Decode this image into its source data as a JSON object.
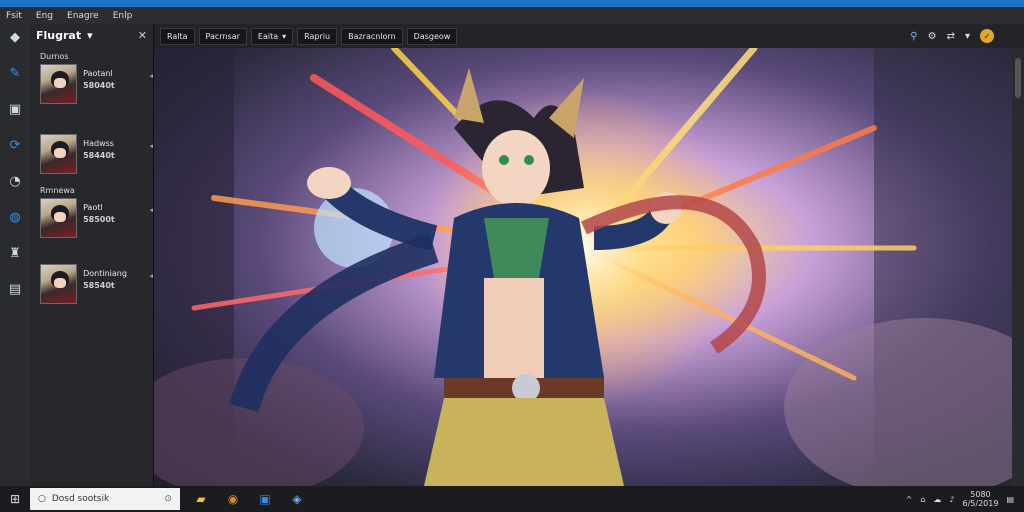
{
  "menu": [
    "Fsit",
    "Eng",
    "Enagre",
    "Enlp"
  ],
  "panel": {
    "title": "Flugrat",
    "groups": [
      {
        "label": "Durnos",
        "item": {
          "name": "Paotanl",
          "count": "58040t"
        }
      },
      {
        "label": "",
        "item": {
          "name": "Hadwss",
          "count": "58440t"
        }
      },
      {
        "label": "Rmnewa",
        "item": {
          "name": "Paotl",
          "count": "58500t"
        }
      },
      {
        "label": "",
        "item": {
          "name": "Dontiniang",
          "count": "58540t"
        }
      }
    ]
  },
  "toolbar": {
    "buttons": [
      "Ralta",
      "Pacrnsar",
      "Eaita",
      "Rapriu",
      "Bazracnlorn",
      "Dasgeow"
    ]
  },
  "taskbar": {
    "search_placeholder": "Dosd sootsik",
    "clock_time": "5080",
    "clock_date": "6/5/2019"
  },
  "icons": {
    "rail": [
      "user-avatar-icon",
      "wrench-icon",
      "save-icon",
      "sync-icon",
      "gauge-icon",
      "globe-icon",
      "stamp-icon",
      "folder-icon"
    ],
    "toolbar_right": [
      "location-icon",
      "settings-icon",
      "transfer-icon",
      "chevron-down-icon",
      "profile-badge-icon"
    ]
  },
  "colors": {
    "accent": "#1a73c7",
    "badge": "#e0a92a"
  }
}
